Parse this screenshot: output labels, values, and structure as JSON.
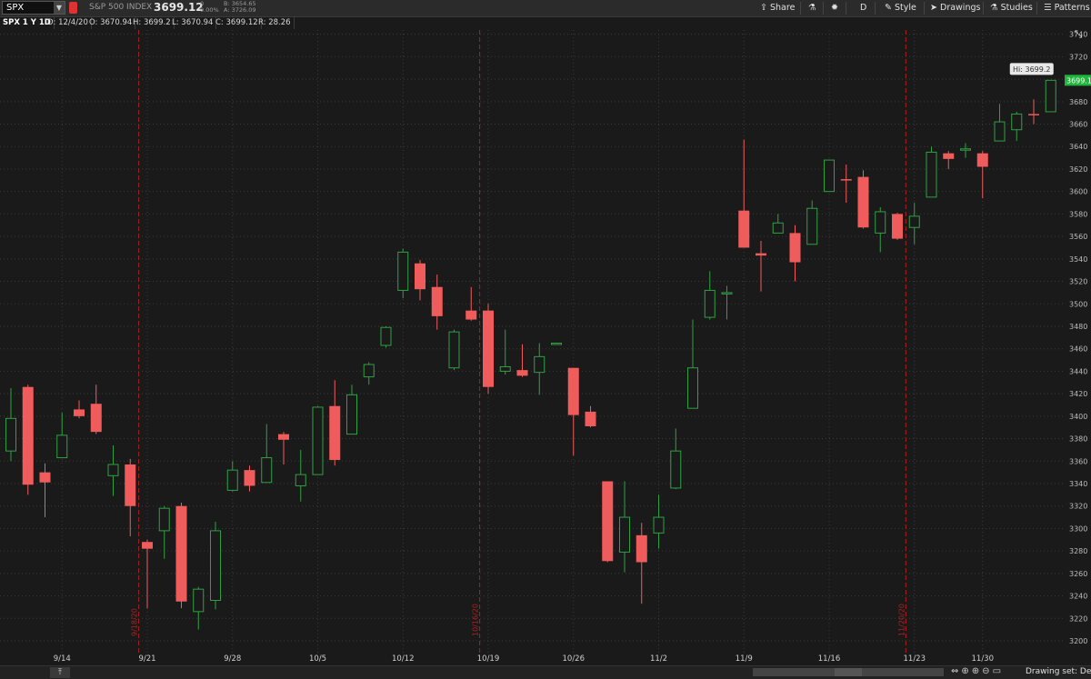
{
  "topbar": {
    "symbol": "SPX",
    "index_name": "S&P 500 INDEX",
    "last": "3699.12",
    "change": "0",
    "change_pct": "0.00%",
    "bid": "B: 3654.65",
    "ask": "A: 3726.09",
    "share": "Share",
    "aggregation": "D",
    "style": "Style",
    "drawings": "Drawings",
    "studies": "Studies",
    "patterns": "Patterns"
  },
  "infobar": {
    "title": "SPX 1 Y 1D",
    "date": "D: 12/4/20",
    "open": "O: 3670.94",
    "high": "H: 3699.2",
    "low": "L: 3670.94",
    "close": "C: 3699.12",
    "range": "R: 28.26"
  },
  "bottombar": {
    "drawing_set": "Drawing set: Defa"
  },
  "colors": {
    "up": "#2ea043",
    "down": "#f05c5c",
    "price_tag": "#1fb53a",
    "grid": "#3a3a3a",
    "divider": "#b02020"
  },
  "chart_data": {
    "type": "candlestick",
    "ylim": [
      3200,
      3740
    ],
    "y_ticks": [
      3200,
      3220,
      3240,
      3260,
      3280,
      3300,
      3320,
      3340,
      3360,
      3380,
      3400,
      3420,
      3440,
      3460,
      3480,
      3500,
      3520,
      3540,
      3560,
      3580,
      3600,
      3620,
      3640,
      3660,
      3680,
      3700,
      3720,
      3740
    ],
    "x_ticks": [
      {
        "label": "9/14",
        "i": 3
      },
      {
        "label": "9/21",
        "i": 8
      },
      {
        "label": "9/28",
        "i": 13
      },
      {
        "label": "10/5",
        "i": 18
      },
      {
        "label": "10/12",
        "i": 23
      },
      {
        "label": "10/19",
        "i": 28
      },
      {
        "label": "10/26",
        "i": 33
      },
      {
        "label": "11/2",
        "i": 38
      },
      {
        "label": "11/9",
        "i": 43
      },
      {
        "label": "11/16",
        "i": 48
      },
      {
        "label": "11/23",
        "i": 53
      },
      {
        "label": "11/30",
        "i": 57
      }
    ],
    "dividers": [
      {
        "label": "9/18/20",
        "i": 7.5
      },
      {
        "label": "10/16/20",
        "i": 27.5
      },
      {
        "label": "11/20/20",
        "i": 52.5
      }
    ],
    "hi_label": "Hi: 3699.2",
    "last_label": "3699.1",
    "candles": [
      {
        "o": 3369,
        "h": 3425,
        "l": 3360,
        "c": 3398
      },
      {
        "o": 3426,
        "h": 3428,
        "l": 3330,
        "c": 3339
      },
      {
        "o": 3350,
        "h": 3358,
        "l": 3310,
        "c": 3341
      },
      {
        "o": 3363,
        "h": 3403,
        "l": 3363,
        "c": 3383
      },
      {
        "o": 3406,
        "h": 3414,
        "l": 3398,
        "c": 3400
      },
      {
        "o": 3411,
        "h": 3428,
        "l": 3384,
        "c": 3386
      },
      {
        "o": 3347,
        "h": 3374,
        "l": 3329,
        "c": 3357
      },
      {
        "o": 3357,
        "h": 3362,
        "l": 3293,
        "c": 3320
      },
      {
        "o": 3288,
        "h": 3290,
        "l": 3229,
        "c": 3282
      },
      {
        "o": 3298,
        "h": 3320,
        "l": 3273,
        "c": 3318
      },
      {
        "o": 3320,
        "h": 3323,
        "l": 3229,
        "c": 3235
      },
      {
        "o": 3226,
        "h": 3248,
        "l": 3210,
        "c": 3246
      },
      {
        "o": 3236,
        "h": 3306,
        "l": 3228,
        "c": 3298
      },
      {
        "o": 3334,
        "h": 3360,
        "l": 3333,
        "c": 3352
      },
      {
        "o": 3352,
        "h": 3356,
        "l": 3333,
        "c": 3338
      },
      {
        "o": 3341,
        "h": 3393,
        "l": 3341,
        "c": 3363
      },
      {
        "o": 3384,
        "h": 3386,
        "l": 3357,
        "c": 3379
      },
      {
        "o": 3338,
        "h": 3370,
        "l": 3324,
        "c": 3348
      },
      {
        "o": 3348,
        "h": 3409,
        "l": 3348,
        "c": 3408
      },
      {
        "o": 3409,
        "h": 3432,
        "l": 3356,
        "c": 3361
      },
      {
        "o": 3384,
        "h": 3428,
        "l": 3384,
        "c": 3419
      },
      {
        "o": 3435,
        "h": 3448,
        "l": 3428,
        "c": 3446
      },
      {
        "o": 3463,
        "h": 3480,
        "l": 3461,
        "c": 3479
      },
      {
        "o": 3512,
        "h": 3549,
        "l": 3505,
        "c": 3546
      },
      {
        "o": 3536,
        "h": 3539,
        "l": 3503,
        "c": 3513
      },
      {
        "o": 3515,
        "h": 3526,
        "l": 3477,
        "c": 3489
      },
      {
        "o": 3443,
        "h": 3477,
        "l": 3441,
        "c": 3475
      },
      {
        "o": 3494,
        "h": 3515,
        "l": 3485,
        "c": 3486
      },
      {
        "o": 3494,
        "h": 3500,
        "l": 3420,
        "c": 3426
      },
      {
        "o": 3440,
        "h": 3477,
        "l": 3437,
        "c": 3444
      },
      {
        "o": 3441,
        "h": 3464,
        "l": 3435,
        "c": 3436
      },
      {
        "o": 3439,
        "h": 3465,
        "l": 3419,
        "c": 3453
      },
      {
        "o": 3465,
        "h": 3465,
        "l": 3465,
        "c": 3465
      },
      {
        "o": 3443,
        "h": 3443,
        "l": 3365,
        "c": 3401
      },
      {
        "o": 3404,
        "h": 3409,
        "l": 3390,
        "c": 3391
      },
      {
        "o": 3342,
        "h": 3342,
        "l": 3270,
        "c": 3271
      },
      {
        "o": 3279,
        "h": 3342,
        "l": 3261,
        "c": 3310
      },
      {
        "o": 3294,
        "h": 3305,
        "l": 3233,
        "c": 3270
      },
      {
        "o": 3296,
        "h": 3330,
        "l": 3282,
        "c": 3310
      },
      {
        "o": 3336,
        "h": 3389,
        "l": 3335,
        "c": 3369
      },
      {
        "o": 3407,
        "h": 3486,
        "l": 3407,
        "c": 3443
      },
      {
        "o": 3488,
        "h": 3529,
        "l": 3486,
        "c": 3512
      },
      {
        "o": 3509,
        "h": 3516,
        "l": 3486,
        "c": 3510
      },
      {
        "o": 3583,
        "h": 3646,
        "l": 3550,
        "c": 3550
      },
      {
        "o": 3545,
        "h": 3556,
        "l": 3511,
        "c": 3543
      },
      {
        "o": 3563,
        "h": 3580,
        "l": 3563,
        "c": 3572
      },
      {
        "o": 3563,
        "h": 3570,
        "l": 3520,
        "c": 3537
      },
      {
        "o": 3553,
        "h": 3592,
        "l": 3553,
        "c": 3585
      },
      {
        "o": 3600,
        "h": 3628,
        "l": 3600,
        "c": 3628
      },
      {
        "o": 3611,
        "h": 3624,
        "l": 3590,
        "c": 3610
      },
      {
        "o": 3613,
        "h": 3619,
        "l": 3567,
        "c": 3568
      },
      {
        "o": 3563,
        "h": 3586,
        "l": 3546,
        "c": 3582
      },
      {
        "o": 3580,
        "h": 3581,
        "l": 3557,
        "c": 3558
      },
      {
        "o": 3568,
        "h": 3590,
        "l": 3553,
        "c": 3578
      },
      {
        "o": 3595,
        "h": 3640,
        "l": 3595,
        "c": 3635
      },
      {
        "o": 3634,
        "h": 3636,
        "l": 3620,
        "c": 3629
      },
      {
        "o": 3638,
        "h": 3643,
        "l": 3630,
        "c": 3638
      },
      {
        "o": 3634,
        "h": 3636,
        "l": 3594,
        "c": 3622
      },
      {
        "o": 3645,
        "h": 3678,
        "l": 3645,
        "c": 3662
      },
      {
        "o": 3655,
        "h": 3671,
        "l": 3645,
        "c": 3669
      },
      {
        "o": 3669,
        "h": 3682,
        "l": 3660,
        "c": 3668
      },
      {
        "o": 3671,
        "h": 3699,
        "l": 3671,
        "c": 3699
      }
    ]
  }
}
